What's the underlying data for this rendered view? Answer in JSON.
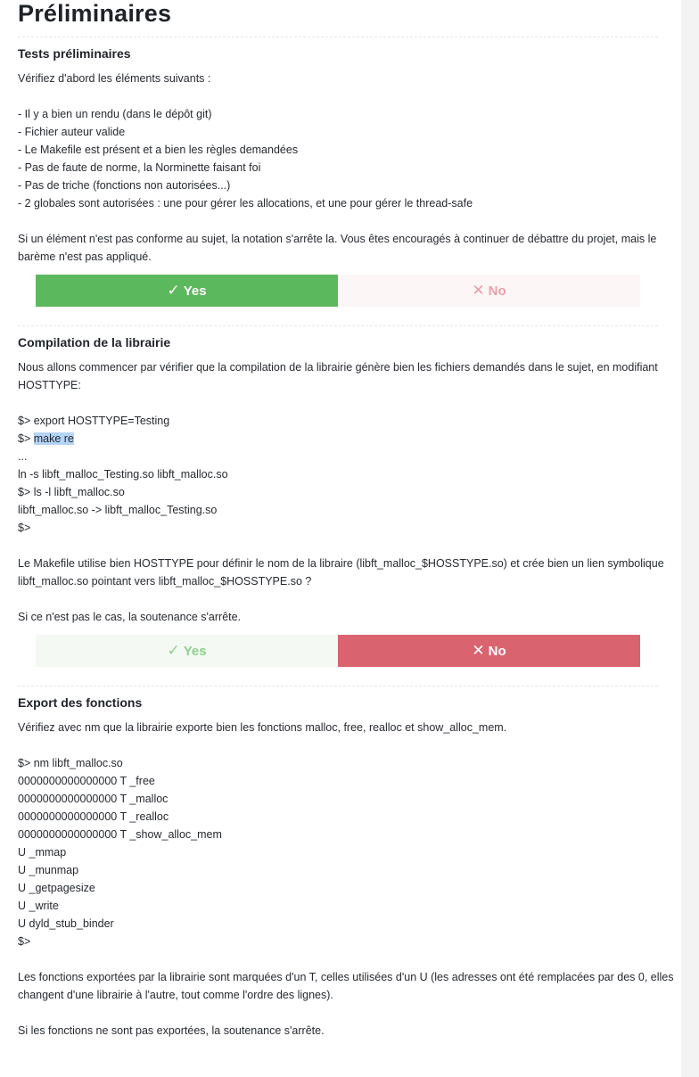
{
  "page_title": "Préliminaires",
  "sections": [
    {
      "title": "Tests préliminaires",
      "lines": [
        "Vérifiez d'abord les éléments suivants :",
        "",
        "- Il y a bien un rendu (dans le dépôt git)",
        "- Fichier auteur valide",
        "- Le Makefile est présent et a bien les règles demandées",
        "- Pas de faute de norme, la Norminette faisant foi",
        "- Pas de triche (fonctions non autorisées...)",
        "- 2 globales sont autorisées : une pour gérer les allocations, et une pour gérer le thread-safe",
        "",
        "Si un élément n'est pas conforme au sujet, la notation s'arrête la. Vous êtes encouragés à continuer de débattre du projet, mais le",
        "barème n'est pas appliqué."
      ],
      "yes_label": "Yes",
      "no_label": "No",
      "selected": "yes"
    },
    {
      "title": "Compilation de la librairie",
      "lines_before": [
        "Nous allons commencer par vérifier que la compilation de la librairie génère bien les fichiers demandés dans le sujet, en modifiant",
        "HOSTTYPE:",
        "",
        "$> export HOSTTYPE=Testing"
      ],
      "cmd_prefix": "$> ",
      "cmd_highlight": "make re",
      "lines_after": [
        "...",
        "ln -s libft_malloc_Testing.so libft_malloc.so",
        "$> ls -l libft_malloc.so",
        "libft_malloc.so -> libft_malloc_Testing.so",
        "$>",
        "",
        "Le Makefile utilise bien HOSTTYPE pour définir le nom de la libraire (libft_malloc_$HOSSTYPE.so) et crée bien un lien symbolique",
        "libft_malloc.so pointant vers libft_malloc_$HOSSTYPE.so ?",
        "",
        "Si ce n'est pas le cas, la soutenance s'arrête."
      ],
      "yes_label": "Yes",
      "no_label": "No",
      "selected": "no"
    },
    {
      "title": "Export des fonctions",
      "lines": [
        "Vérifiez avec nm que la librairie exporte bien les fonctions malloc, free, realloc et show_alloc_mem.",
        "",
        "$> nm libft_malloc.so",
        "0000000000000000 T _free",
        "0000000000000000 T _malloc",
        "0000000000000000 T _realloc",
        "0000000000000000 T _show_alloc_mem",
        "U _mmap",
        "U _munmap",
        "U _getpagesize",
        "U _write",
        "U dyld_stub_binder",
        "$>",
        "",
        "Les fonctions exportées par la librairie sont marquées d'un T, celles utilisées d'un U (les adresses ont été remplacées par des 0, elles",
        "changent d'une librairie à l'autre, tout comme l'ordre des lignes).",
        "",
        "Si les fonctions ne sont pas exportées, la soutenance s'arrête."
      ]
    }
  ],
  "icons": {
    "yes": "check-icon",
    "no": "cross-icon"
  },
  "colors": {
    "yes_active": "#5cb85c",
    "no_active": "#d9636f"
  }
}
